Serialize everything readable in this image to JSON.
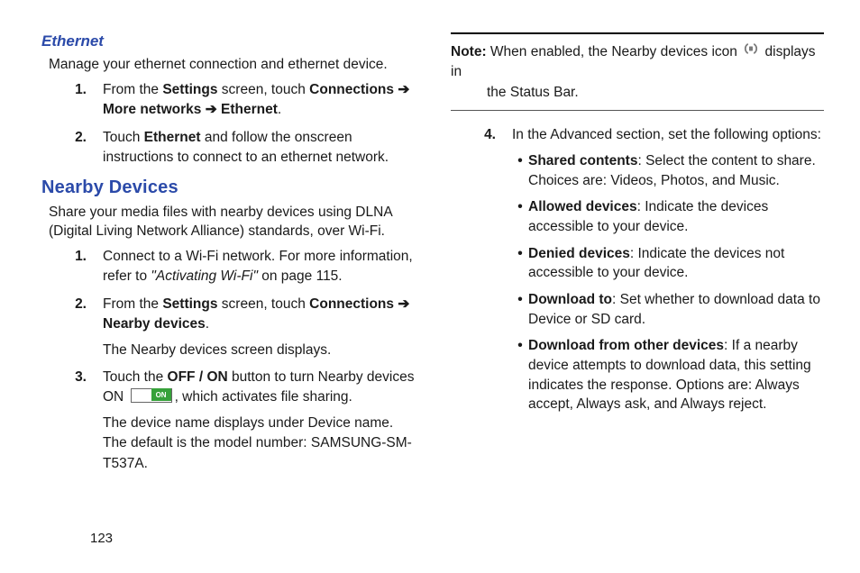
{
  "left": {
    "ethernet": {
      "heading": "Ethernet",
      "intro": "Manage your ethernet connection and ethernet device.",
      "steps": [
        {
          "n": "1.",
          "pre": "From the ",
          "b1": "Settings",
          "mid1": " screen, touch ",
          "b2": "Connections",
          "arrow1": " ➔ ",
          "b3": "More networks",
          "arrow2": " ➔ ",
          "b4": "Ethernet",
          "end": "."
        },
        {
          "n": "2.",
          "pre": "Touch ",
          "b1": "Ethernet",
          "end": " and follow the onscreen instructions to connect to an ethernet network."
        }
      ]
    },
    "nearby": {
      "heading": "Nearby Devices",
      "intro": "Share your media files with nearby devices using DLNA (Digital Living Network Alliance) standards, over Wi-Fi.",
      "steps": [
        {
          "n": "1.",
          "pre": "Connect to a Wi-Fi network. For more information, refer to ",
          "i1": "\"Activating Wi-Fi\"",
          "end": " on page 115."
        },
        {
          "n": "2.",
          "pre": "From the ",
          "b1": "Settings",
          "mid1": " screen, touch ",
          "b2": "Connections",
          "arrow1": " ➔ ",
          "b3": "Nearby devices",
          "end1": ".",
          "line2": "The Nearby devices screen displays."
        },
        {
          "n": "3.",
          "pre": "Touch the ",
          "b1": "OFF / ON",
          "mid1": " button to turn Nearby devices ON ",
          "post": ", which activates file sharing.",
          "line2": "The device name displays under Device name. The default is the model number: SAMSUNG-SM-T537A."
        }
      ]
    }
  },
  "right": {
    "note": {
      "label": "Note:",
      "line1a": " When enabled, the Nearby devices icon ",
      "line1b": " displays in",
      "line2": "the Status Bar."
    },
    "step4": {
      "n": "4.",
      "text": "In the Advanced section, set the following options:",
      "bullets": [
        {
          "b": "Shared contents",
          "t": ": Select the content to share. Choices are: Videos, Photos, and Music."
        },
        {
          "b": "Allowed devices",
          "t": ": Indicate the devices accessible to your device."
        },
        {
          "b": "Denied devices",
          "t": ": Indicate the devices not accessible to your device."
        },
        {
          "b": "Download to",
          "t": ": Set whether to download data to Device or SD card."
        },
        {
          "b": "Download from other devices",
          "t": ": If a nearby device attempts to download data, this setting indicates the response. Options are: Always accept, Always ask, and Always reject."
        }
      ]
    }
  },
  "page_number": "123"
}
